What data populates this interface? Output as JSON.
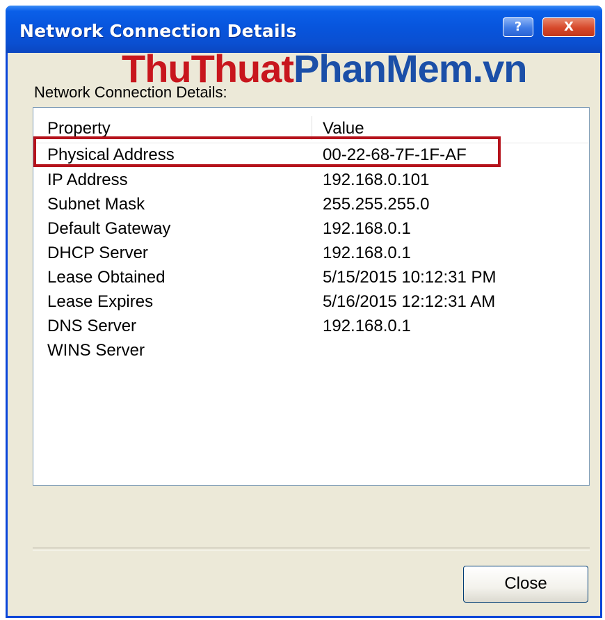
{
  "window": {
    "title": "Network Connection Details",
    "help_label": "?",
    "close_label": "X"
  },
  "watermark": {
    "part1": "ThuThuat",
    "part2": "PhanMem.vn"
  },
  "group_label": "Network Connection Details:",
  "table": {
    "columns": [
      "Property",
      "Value"
    ],
    "rows": [
      {
        "property": "Physical Address",
        "value": "00-22-68-7F-1F-AF"
      },
      {
        "property": "IP Address",
        "value": "192.168.0.101"
      },
      {
        "property": "Subnet Mask",
        "value": "255.255.255.0"
      },
      {
        "property": "Default Gateway",
        "value": "192.168.0.1"
      },
      {
        "property": "DHCP Server",
        "value": "192.168.0.1"
      },
      {
        "property": "Lease Obtained",
        "value": "5/15/2015 10:12:31 PM"
      },
      {
        "property": "Lease Expires",
        "value": "5/16/2015 12:12:31 AM"
      },
      {
        "property": "DNS Server",
        "value": "192.168.0.1"
      },
      {
        "property": "WINS Server",
        "value": ""
      }
    ],
    "highlighted_row": "Physical Address"
  },
  "buttons": {
    "close_label": "Close"
  },
  "colors": {
    "titlebar": "#0855dd",
    "highlight_border": "#b5121b",
    "watermark_red": "#c8161d",
    "watermark_blue": "#1b4fa8"
  }
}
